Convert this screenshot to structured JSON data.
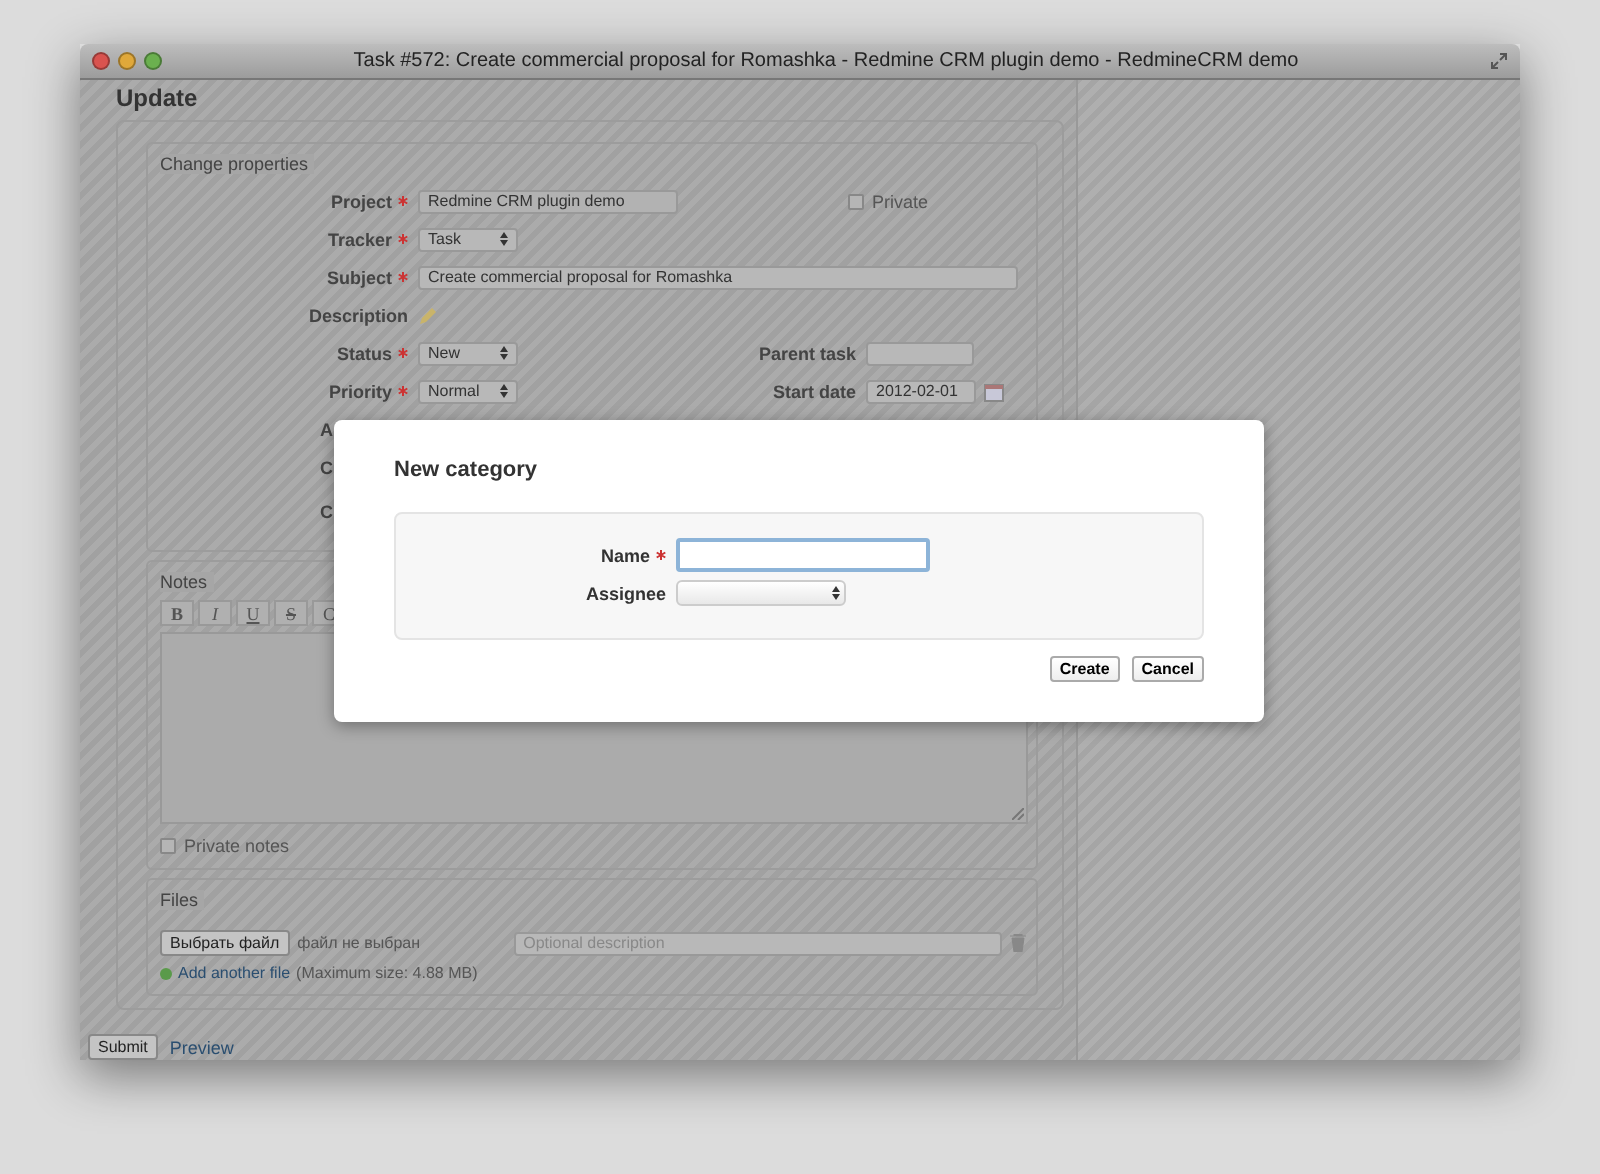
{
  "window": {
    "title": "Task #572: Create commercial proposal for Romashka - Redmine CRM plugin demo - RedmineCRM demo"
  },
  "heading": "Update",
  "properties": {
    "legend": "Change properties",
    "rows": [
      {
        "left": {
          "kind": "readonly",
          "label": "Project",
          "required": true,
          "value": "Redmine CRM plugin demo"
        },
        "right": {
          "kind": "checkbox",
          "label": "Private",
          "checked": false
        }
      },
      {
        "left": {
          "kind": "select",
          "label": "Tracker",
          "required": true,
          "value": "Task"
        }
      },
      {
        "left": {
          "kind": "wide",
          "label": "Subject",
          "required": true,
          "value": "Create commercial proposal for Romashka"
        }
      },
      {
        "left": {
          "kind": "edit",
          "label": "Description",
          "required": false
        }
      },
      {
        "left": {
          "kind": "select",
          "label": "Status",
          "required": true,
          "value": "New"
        },
        "right": {
          "kind": "text",
          "label": "Parent task"
        }
      },
      {
        "left": {
          "kind": "select",
          "label": "Priority",
          "required": true,
          "value": "Normal"
        },
        "right": {
          "kind": "date",
          "label": "Start date",
          "value": "2012-02-01"
        }
      },
      {
        "left": {
          "kind": "cut",
          "label": "A"
        }
      },
      {
        "left": {
          "kind": "cut",
          "label": "C"
        }
      },
      {
        "left": {
          "kind": "cut",
          "label": "C"
        }
      }
    ]
  },
  "notes": {
    "legend": "Notes",
    "toolbar": [
      {
        "kind": "bold",
        "label": "B"
      },
      {
        "kind": "italic",
        "label": "I"
      },
      {
        "kind": "underline",
        "label": "U"
      },
      {
        "kind": "strike",
        "label": "S"
      },
      {
        "kind": "plain",
        "label": "C"
      }
    ],
    "private_notes": {
      "label": "Private notes",
      "checked": false
    }
  },
  "files": {
    "legend": "Files",
    "choose_button": "Выбрать файл",
    "no_file": "файл не выбран",
    "description_placeholder": "Optional description",
    "add_link": "Add another file",
    "max_size": "(Maximum size: 4.88 MB)"
  },
  "actions": {
    "submit": "Submit",
    "preview": "Preview"
  },
  "dialog": {
    "title": "New category",
    "fields": [
      {
        "kind": "input",
        "label": "Name",
        "required": true
      },
      {
        "kind": "select",
        "label": "Assignee",
        "required": false
      }
    ],
    "buttons": [
      "Create",
      "Cancel"
    ]
  }
}
